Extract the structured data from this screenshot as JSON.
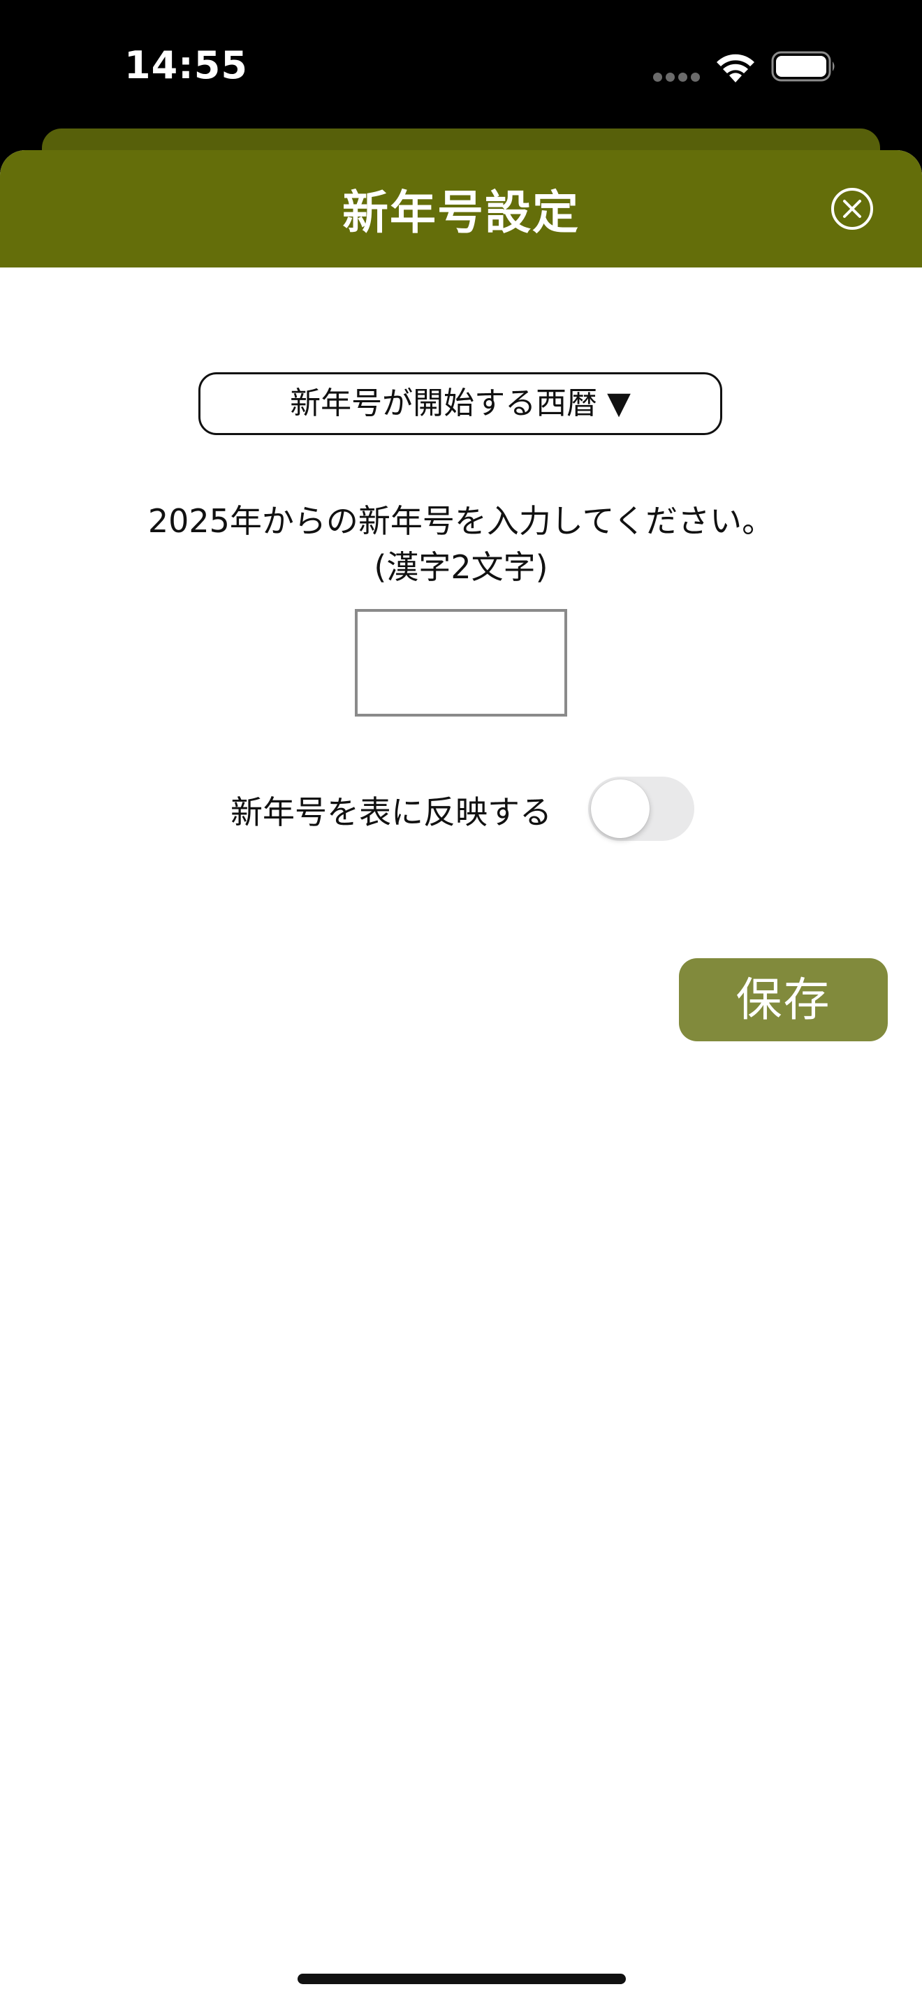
{
  "status_bar": {
    "time": "14:55"
  },
  "sheet": {
    "title": "新年号設定"
  },
  "dropdown": {
    "label": "新年号が開始する西暦 ▼"
  },
  "instruction": {
    "line1": "2025年からの新年号を入力してください。",
    "line2": "(漢字2文字)"
  },
  "era_input": {
    "value": "",
    "placeholder": ""
  },
  "reflect_toggle": {
    "label": "新年号を表に反映する",
    "on": false
  },
  "save_button": {
    "label": "保存"
  },
  "colors": {
    "header": "#646e0a",
    "back_sheet": "#57600a",
    "save_button": "#818a3c",
    "toggle_off": "#e9e9ea"
  },
  "icons": {
    "close": "close-circle-icon",
    "wifi": "wifi-icon",
    "battery": "battery-icon",
    "signal": "signal-dots-icon"
  }
}
